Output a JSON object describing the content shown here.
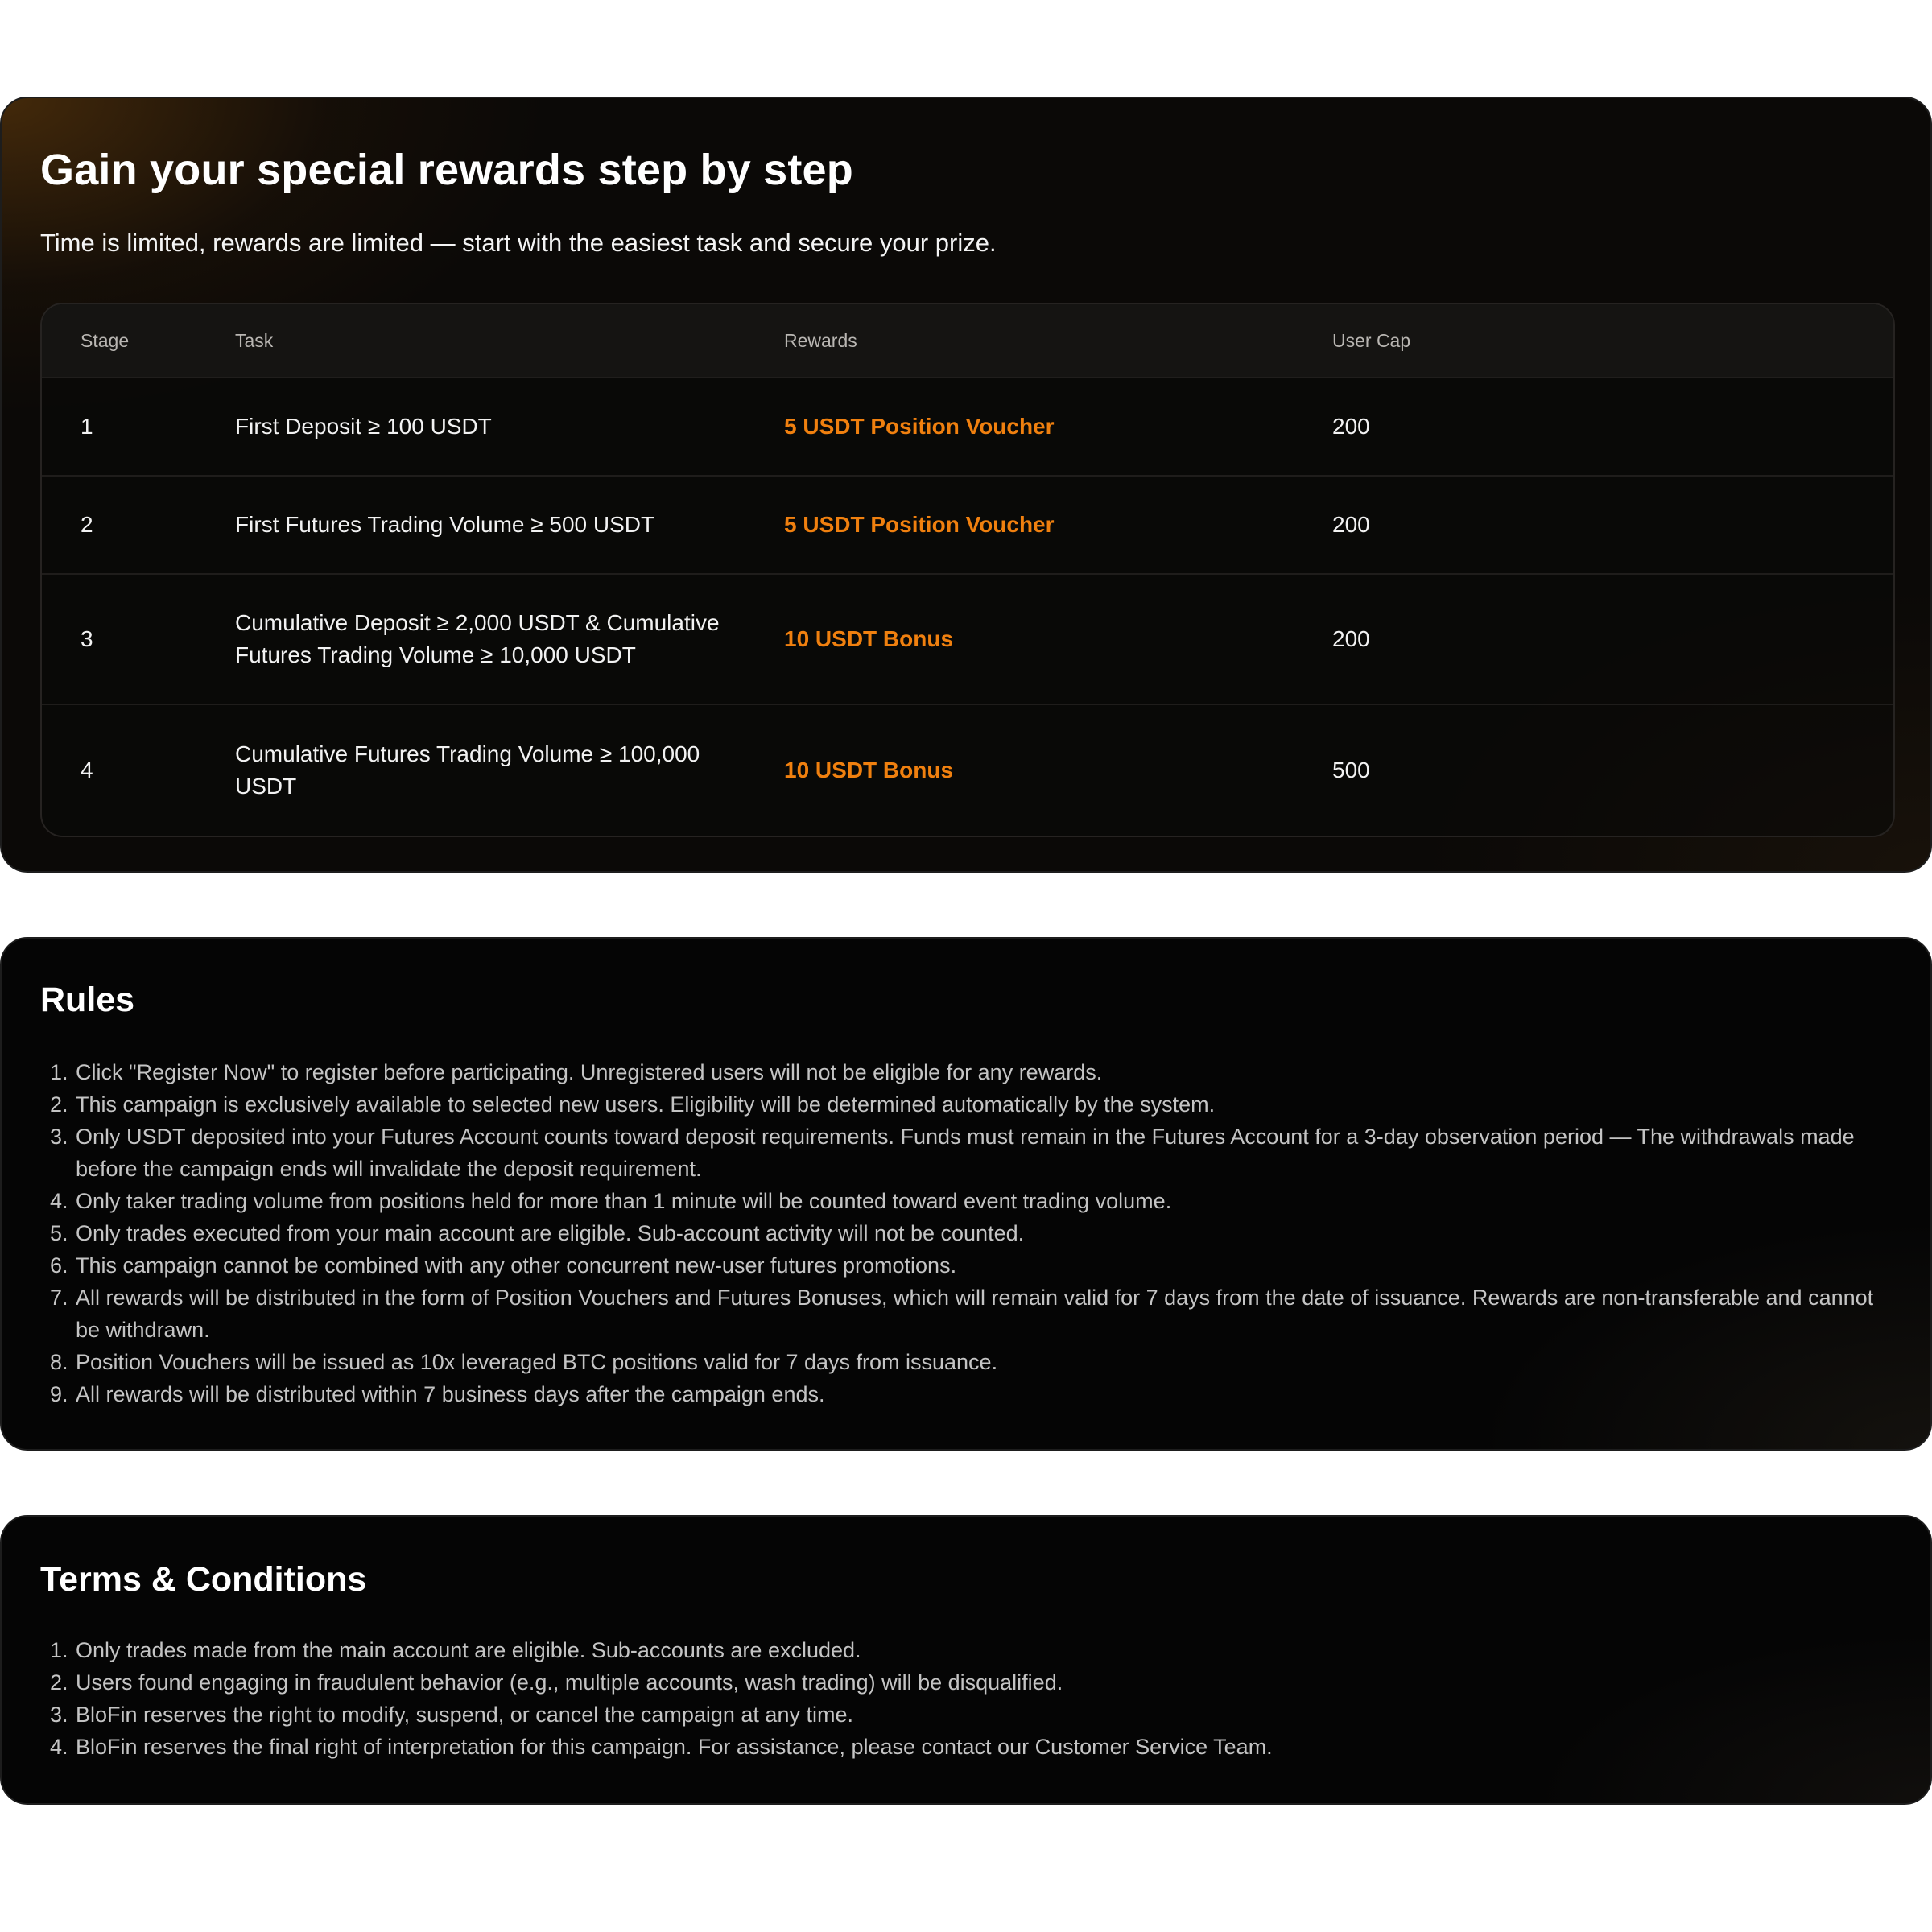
{
  "rewards": {
    "title": "Gain your special rewards step by step",
    "subtitle": "Time is limited, rewards are limited — start with the easiest task and secure your prize.",
    "table": {
      "headers": {
        "stage": "Stage",
        "task": "Task",
        "rewards": "Rewards",
        "user_cap": "User Cap"
      },
      "rows": [
        {
          "stage": "1",
          "task": "First Deposit ≥ 100 USDT",
          "reward": "5 USDT Position Voucher",
          "cap": "200"
        },
        {
          "stage": "2",
          "task": "First Futures Trading Volume ≥ 500 USDT",
          "reward": "5 USDT Position Voucher",
          "cap": "200"
        },
        {
          "stage": "3",
          "task": "Cumulative Deposit ≥ 2,000 USDT & Cumulative Futures Trading Volume ≥ 10,000 USDT",
          "reward": "10 USDT Bonus",
          "cap": "200"
        },
        {
          "stage": "4",
          "task": "Cumulative Futures Trading Volume ≥ 100,000 USDT",
          "reward": "10 USDT Bonus",
          "cap": "500"
        }
      ]
    }
  },
  "rules": {
    "title": "Rules",
    "items": [
      "Click \"Register Now\" to register before participating. Unregistered users will not be eligible for any rewards.",
      "This campaign is exclusively available to selected new users. Eligibility will be determined automatically by the system.",
      "Only USDT deposited into your Futures Account counts toward deposit requirements. Funds must remain in the Futures Account for a 3-day observation period — The withdrawals made before the campaign ends will invalidate the deposit requirement.",
      "Only taker trading volume from positions held for more than 1 minute will be counted toward event trading volume.",
      "Only trades executed from your main account are eligible. Sub-account activity will not be counted.",
      "This campaign cannot be combined with any other concurrent new-user futures promotions.",
      "All rewards will be distributed in the form of Position Vouchers and Futures Bonuses, which will remain valid for 7 days from the date of issuance. Rewards are non-transferable and cannot be withdrawn.",
      "Position Vouchers will be issued as 10x leveraged BTC positions valid for 7 days from issuance.",
      "All rewards will be distributed within 7 business days after the campaign ends."
    ]
  },
  "terms": {
    "title": "Terms & Conditions",
    "items": [
      "Only trades made from the main account are eligible. Sub-accounts are excluded.",
      "Users found engaging in fraudulent behavior (e.g., multiple accounts, wash trading) will be disqualified.",
      "BloFin reserves the right to modify, suspend, or cancel the campaign at any time.",
      "BloFin reserves the final right of interpretation for this campaign. For assistance, please contact our Customer Service Team."
    ]
  },
  "colors": {
    "accent_reward": "#f0800f",
    "card_background": "#050505",
    "page_background": "#ffffff"
  }
}
